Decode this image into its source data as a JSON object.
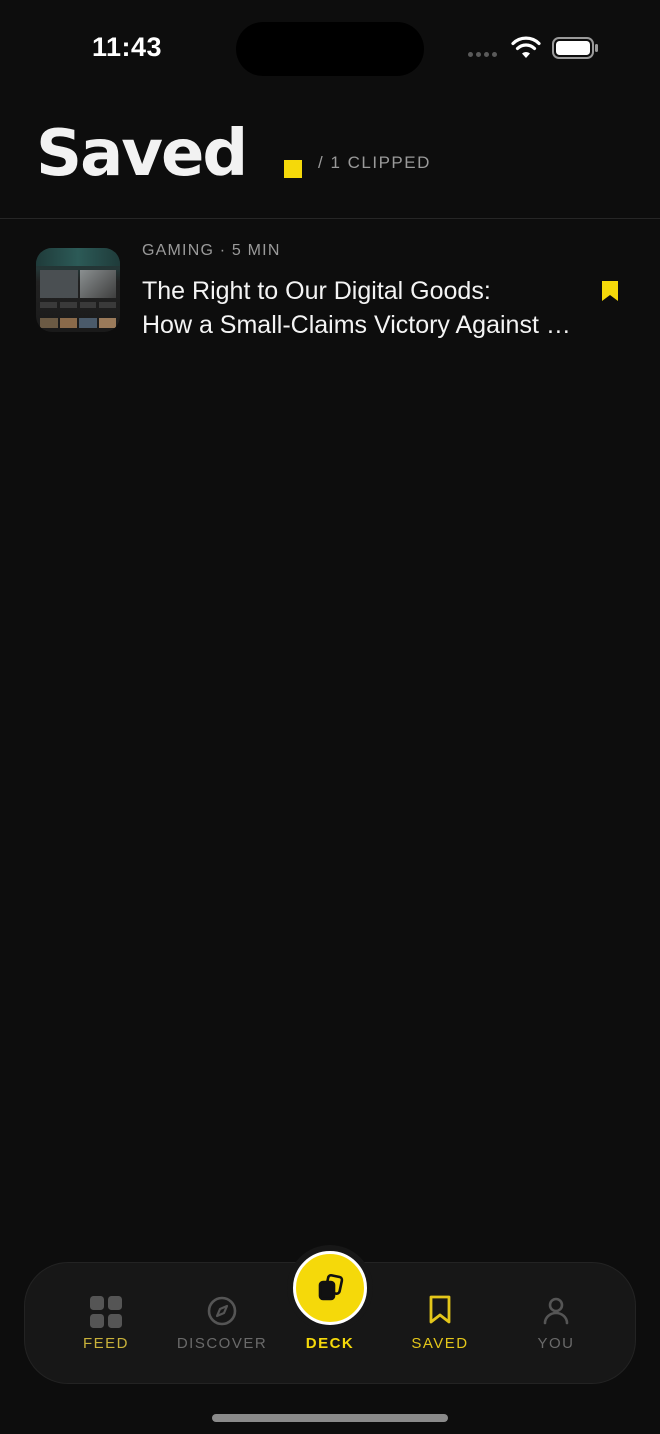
{
  "status_bar": {
    "time": "11:43"
  },
  "header": {
    "title": "Saved",
    "count_label": "/ 1 CLIPPED"
  },
  "colors": {
    "accent": "#f5d90a",
    "background": "#0d0d0d",
    "muted": "#9a9a9a"
  },
  "saved_items": [
    {
      "meta": "GAMING · 5 MIN",
      "title_line1": "The Right to Our Digital Goods:",
      "title_line2": "How a Small-Claims Victory Against Valve",
      "bookmark_icon": "bookmark-filled-icon"
    }
  ],
  "tab_bar": {
    "tabs": [
      {
        "label": "FEED",
        "icon": "grid-icon"
      },
      {
        "label": "DISCOVER",
        "icon": "compass-icon"
      },
      {
        "label": "DECK",
        "icon": "cards-icon"
      },
      {
        "label": "SAVED",
        "icon": "bookmark-icon"
      },
      {
        "label": "YOU",
        "icon": "person-icon"
      }
    ]
  }
}
